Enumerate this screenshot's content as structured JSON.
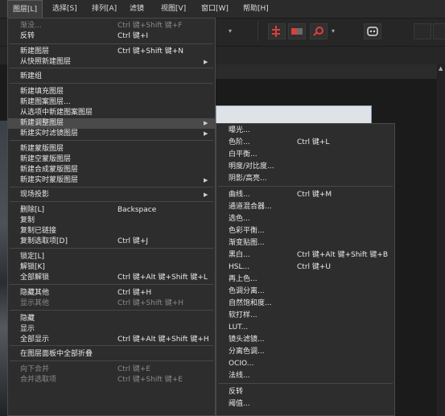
{
  "menubar": [
    "图层[L]",
    "选择[S]",
    "排列[A]",
    "滤镜",
    "视图[V]",
    "窗口[W]",
    "帮助[H]"
  ],
  "menu": {
    "items": [
      {
        "label": "渐没...",
        "shortcut": "Ctrl 键+Shift 键+F",
        "disabled": true
      },
      {
        "label": "反转",
        "shortcut": "Ctrl 键+I"
      },
      {
        "label": "新建图层",
        "shortcut": "Ctrl 键+Shift 键+N"
      },
      {
        "label": "从快照新建图层",
        "submenu": true
      },
      {
        "label": "新建组"
      },
      {
        "label": "新建填充图层"
      },
      {
        "label": "新建图案图层..."
      },
      {
        "label": "从选项中新建图案图层"
      },
      {
        "label": "新建调整图层",
        "submenu": true,
        "highlighted": true
      },
      {
        "label": "新建实时滤镜图层",
        "submenu": true
      },
      {
        "label": "新建蒙版图层"
      },
      {
        "label": "新建空蒙版图层"
      },
      {
        "label": "新建合成蒙版图层"
      },
      {
        "label": "新建实时蒙版图层",
        "submenu": true
      },
      {
        "label": "现场投影",
        "submenu": true
      },
      {
        "label": "删除[L]",
        "shortcut": "Backspace"
      },
      {
        "label": "复制"
      },
      {
        "label": "复制已链接"
      },
      {
        "label": "复制选取项[D]",
        "shortcut": "Ctrl 键+J"
      },
      {
        "label": "锁定[L]"
      },
      {
        "label": "解锁[K]"
      },
      {
        "label": "全部解锁",
        "shortcut": "Ctrl 键+Alt 键+Shift 键+L"
      },
      {
        "label": "隐藏其他",
        "shortcut": "Ctrl 键+H"
      },
      {
        "label": "显示其他",
        "shortcut": "Ctrl 键+Shift 键+H",
        "disabled": true
      },
      {
        "label": "隐藏"
      },
      {
        "label": "显示"
      },
      {
        "label": "全部显示",
        "shortcut": "Ctrl 键+Alt 键+Shift 键+H"
      },
      {
        "label": "在图层面板中全部折叠"
      },
      {
        "label": "向下合并",
        "shortcut": "Ctrl 键+E",
        "disabled": true
      },
      {
        "label": "合并选取项",
        "shortcut": "Ctrl 键+Shift 键+E",
        "disabled": true
      }
    ]
  },
  "submenu": {
    "items": [
      {
        "label": "曝光..."
      },
      {
        "label": "色阶...",
        "shortcut": "Ctrl 键+L"
      },
      {
        "label": "白平衡..."
      },
      {
        "label": "明度/对比度..."
      },
      {
        "label": "阴影/高亮..."
      },
      {
        "label": "曲线...",
        "shortcut": "Ctrl 键+M"
      },
      {
        "label": "通道混合器..."
      },
      {
        "label": "选色..."
      },
      {
        "label": "色彩平衡..."
      },
      {
        "label": "渐变贴图..."
      },
      {
        "label": "黑白...",
        "shortcut": "Ctrl 键+Alt 键+Shift 键+B"
      },
      {
        "label": "HSL...",
        "shortcut": "Ctrl 键+U"
      },
      {
        "label": "再上色..."
      },
      {
        "label": "色调分离..."
      },
      {
        "label": "自然饱和度..."
      },
      {
        "label": "软打样..."
      },
      {
        "label": "LUT..."
      },
      {
        "label": "镜头滤镜..."
      },
      {
        "label": "分离色调..."
      },
      {
        "label": "OCIO..."
      },
      {
        "label": "法线..."
      },
      {
        "label": "反转"
      },
      {
        "label": "阈值..."
      }
    ]
  },
  "colors": {
    "accent_red": "#d9403a",
    "menu_bg": "#2d2d2d",
    "highlight": "#4a4a4a"
  }
}
